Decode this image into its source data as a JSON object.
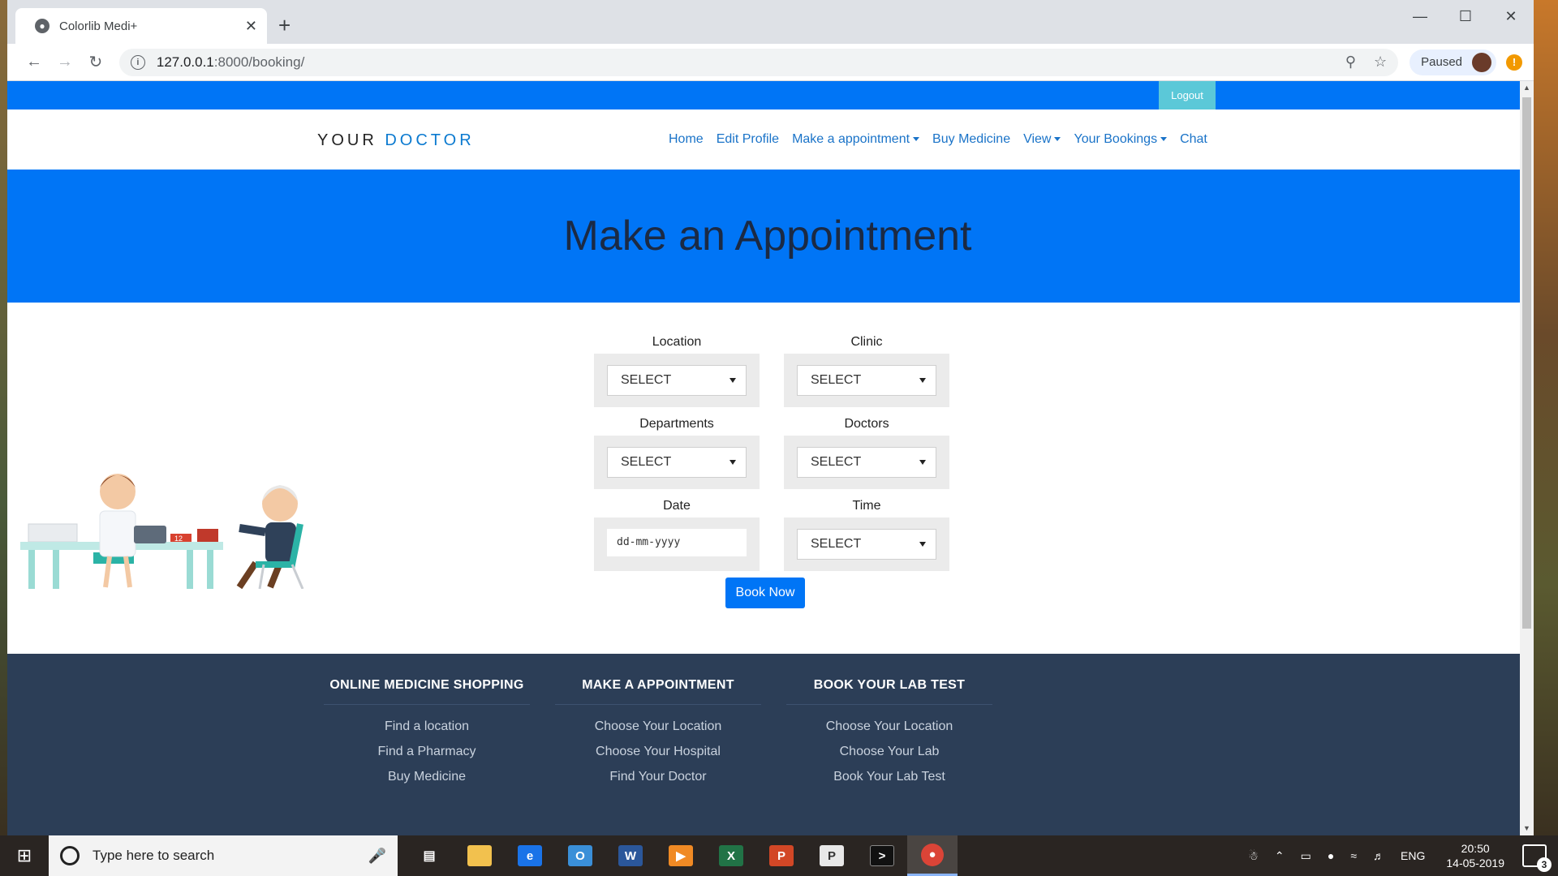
{
  "browser": {
    "tab_title": "Colorlib Medi+",
    "new_tab": "+",
    "url_host": "127.0.0.1",
    "url_path": ":8000/booking/",
    "profile_label": "Paused"
  },
  "site": {
    "logout_label": "Logout",
    "brand_first": "YOUR",
    "brand_second": "DOCTOR",
    "nav": [
      {
        "label": "Home"
      },
      {
        "label": "Edit Profile"
      },
      {
        "label": "Make a appointment"
      },
      {
        "label": "Buy Medicine"
      },
      {
        "label": "View"
      },
      {
        "label": "Your Bookings"
      },
      {
        "label": "Chat"
      }
    ],
    "hero_title": "Make an Appointment"
  },
  "form": {
    "location_label": "Location",
    "location_value": "SELECT",
    "clinic_label": "Clinic",
    "clinic_value": "SELECT",
    "departments_label": "Departments",
    "departments_value": "SELECT",
    "doctors_label": "Doctors",
    "doctors_value": "SELECT",
    "date_label": "Date",
    "date_placeholder": "dd-mm-yyyy",
    "time_label": "Time",
    "time_value": "SELECT",
    "book_label": "Book Now"
  },
  "footer": {
    "columns": [
      {
        "heading": "ONLINE MEDICINE SHOPPING",
        "links": [
          "Find a location",
          "Find a Pharmacy",
          "Buy Medicine"
        ]
      },
      {
        "heading": "MAKE A APPOINTMENT",
        "links": [
          "Choose Your Location",
          "Choose Your Hospital",
          "Find Your Doctor"
        ]
      },
      {
        "heading": "BOOK YOUR LAB TEST",
        "links": [
          "Choose Your Location",
          "Choose Your Lab",
          "Book Your Lab Test"
        ]
      }
    ]
  },
  "taskbar": {
    "search_placeholder": "Type here to search",
    "language": "ENG",
    "time": "20:50",
    "date": "14-05-2019",
    "notification_count": "3"
  },
  "colors": {
    "brand_blue": "#0075f6",
    "logout_teal": "#5bc8d8",
    "footer_navy": "#2c3e57",
    "hero_text": "#1b2a44"
  }
}
